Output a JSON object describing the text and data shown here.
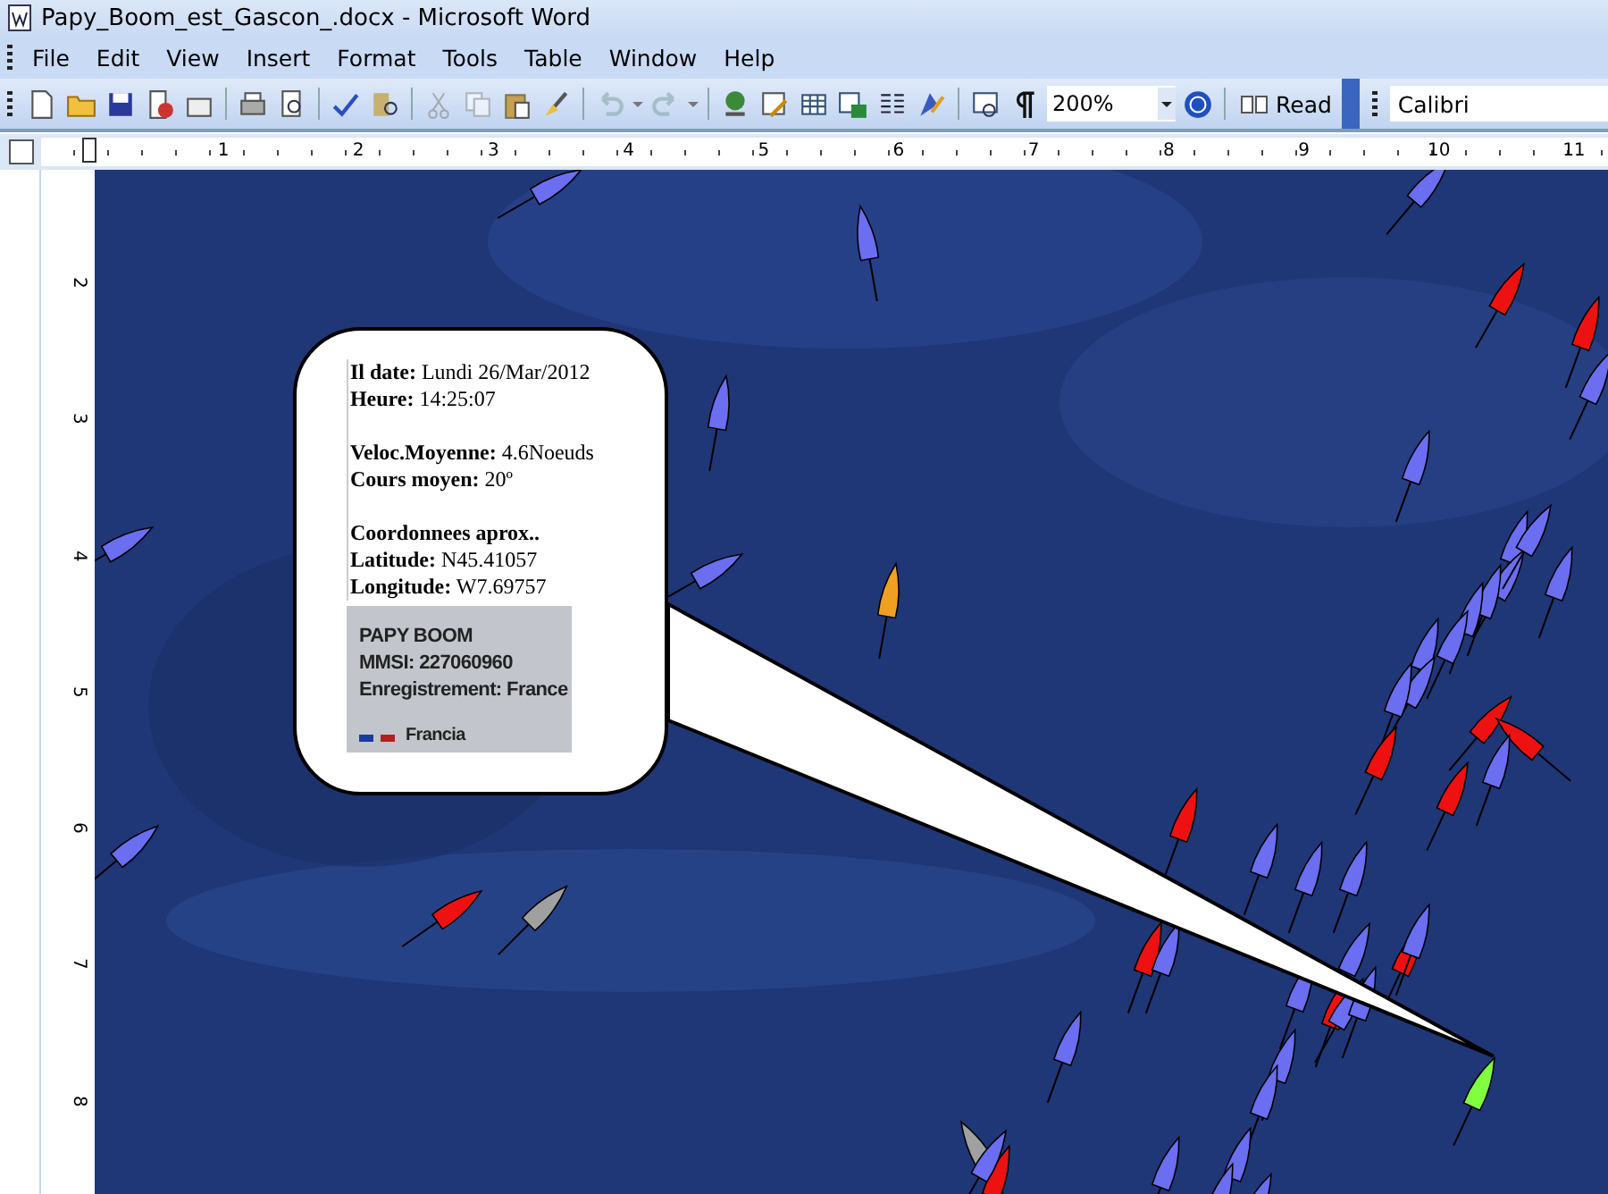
{
  "window": {
    "title": "Papy_Boom_est_Gascon_.docx - Microsoft Word"
  },
  "menu": [
    "File",
    "Edit",
    "View",
    "Insert",
    "Format",
    "Tools",
    "Table",
    "Window",
    "Help"
  ],
  "toolbar": {
    "zoom": "200%",
    "read": "Read",
    "font": "Calibri"
  },
  "ruler": {
    "horizontal": [
      "1",
      "2",
      "3",
      "4",
      "5",
      "6",
      "7",
      "8",
      "9",
      "10",
      "11"
    ],
    "vertical": [
      "2",
      "3",
      "4",
      "5",
      "6",
      "7",
      "8"
    ]
  },
  "callout": {
    "groups": [
      [
        {
          "label": "Il date:",
          "value": "Lundi 26/Mar/2012"
        },
        {
          "label": "Heure:",
          "value": "14:25:07"
        }
      ],
      [
        {
          "label": "Veloc.Moyenne:",
          "value": "4.6Noeuds"
        },
        {
          "label": "Cours moyen:",
          "value": "20º"
        }
      ],
      [
        {
          "label": "Coordonnees aprox.."
        },
        {
          "label": "Latitude:",
          "value": "N45.41057"
        },
        {
          "label": "Longitude:",
          "value": "W7.69757"
        }
      ]
    ],
    "card": {
      "lines": [
        "PAPY BOOM",
        "MMSI: 227060960",
        "Enregistrement: France"
      ],
      "flag_label": "Francia"
    }
  }
}
